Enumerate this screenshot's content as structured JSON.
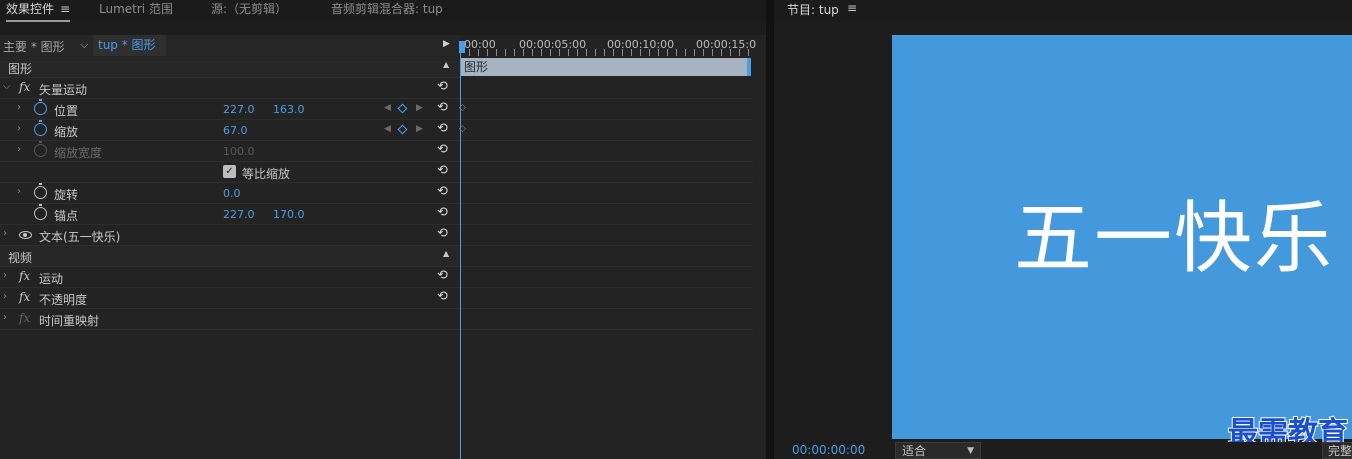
{
  "tabs": [
    {
      "label": "效果控件",
      "active": true
    },
    {
      "label": "Lumetri 范围",
      "active": false
    },
    {
      "label": "源:（无剪辑）",
      "active": false
    },
    {
      "label": "音频剪辑混合器: tup",
      "active": false
    }
  ],
  "menu_glyph": "≡",
  "clip_selector": {
    "master": "主要 * 图形",
    "sequence": "tup * 图形"
  },
  "timeline": {
    "ticks": [
      "00:00",
      "00:00:05:00",
      "00:00:10:00",
      "00:00:15:0"
    ],
    "clip_label": "图形"
  },
  "sections": {
    "graphic": "图形",
    "video": "视频"
  },
  "vector_motion": {
    "label": "矢量运动",
    "properties": {
      "position": {
        "label": "位置",
        "x": "227.0",
        "y": "163.0"
      },
      "scale": {
        "label": "缩放",
        "value": "67.0"
      },
      "scale_width": {
        "label": "缩放宽度",
        "value": "100.0"
      },
      "uniform_scale": {
        "label": "等比缩放",
        "checked": true
      },
      "rotation": {
        "label": "旋转",
        "value": "0.0"
      },
      "anchor": {
        "label": "锚点",
        "x": "227.0",
        "y": "170.0"
      }
    }
  },
  "text_layer": {
    "label": "文本(五一快乐)"
  },
  "video_effects": [
    {
      "label": "运动",
      "enabled": true
    },
    {
      "label": "不透明度",
      "enabled": true
    },
    {
      "label": "时间重映射",
      "enabled": false
    }
  ],
  "program_monitor": {
    "title": "节目: tup",
    "frame_text": "五一快乐",
    "frame_color": "#4399db",
    "timecode": "00:00:00:00",
    "fit_option": "适合",
    "resolution_option": "完整"
  },
  "watermark": "最需教育",
  "accent_color": "#4a9ee6"
}
